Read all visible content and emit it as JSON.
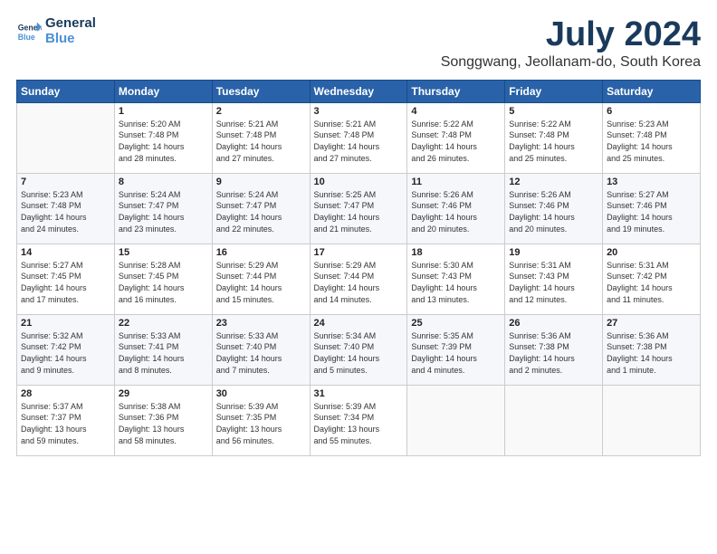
{
  "logo": {
    "line1": "General",
    "line2": "Blue"
  },
  "title": "July 2024",
  "location": "Songgwang, Jeollanam-do, South Korea",
  "days_of_week": [
    "Sunday",
    "Monday",
    "Tuesday",
    "Wednesday",
    "Thursday",
    "Friday",
    "Saturday"
  ],
  "weeks": [
    [
      {
        "day": "",
        "content": ""
      },
      {
        "day": "1",
        "content": "Sunrise: 5:20 AM\nSunset: 7:48 PM\nDaylight: 14 hours\nand 28 minutes."
      },
      {
        "day": "2",
        "content": "Sunrise: 5:21 AM\nSunset: 7:48 PM\nDaylight: 14 hours\nand 27 minutes."
      },
      {
        "day": "3",
        "content": "Sunrise: 5:21 AM\nSunset: 7:48 PM\nDaylight: 14 hours\nand 27 minutes."
      },
      {
        "day": "4",
        "content": "Sunrise: 5:22 AM\nSunset: 7:48 PM\nDaylight: 14 hours\nand 26 minutes."
      },
      {
        "day": "5",
        "content": "Sunrise: 5:22 AM\nSunset: 7:48 PM\nDaylight: 14 hours\nand 25 minutes."
      },
      {
        "day": "6",
        "content": "Sunrise: 5:23 AM\nSunset: 7:48 PM\nDaylight: 14 hours\nand 25 minutes."
      }
    ],
    [
      {
        "day": "7",
        "content": "Sunrise: 5:23 AM\nSunset: 7:48 PM\nDaylight: 14 hours\nand 24 minutes."
      },
      {
        "day": "8",
        "content": "Sunrise: 5:24 AM\nSunset: 7:47 PM\nDaylight: 14 hours\nand 23 minutes."
      },
      {
        "day": "9",
        "content": "Sunrise: 5:24 AM\nSunset: 7:47 PM\nDaylight: 14 hours\nand 22 minutes."
      },
      {
        "day": "10",
        "content": "Sunrise: 5:25 AM\nSunset: 7:47 PM\nDaylight: 14 hours\nand 21 minutes."
      },
      {
        "day": "11",
        "content": "Sunrise: 5:26 AM\nSunset: 7:46 PM\nDaylight: 14 hours\nand 20 minutes."
      },
      {
        "day": "12",
        "content": "Sunrise: 5:26 AM\nSunset: 7:46 PM\nDaylight: 14 hours\nand 20 minutes."
      },
      {
        "day": "13",
        "content": "Sunrise: 5:27 AM\nSunset: 7:46 PM\nDaylight: 14 hours\nand 19 minutes."
      }
    ],
    [
      {
        "day": "14",
        "content": "Sunrise: 5:27 AM\nSunset: 7:45 PM\nDaylight: 14 hours\nand 17 minutes."
      },
      {
        "day": "15",
        "content": "Sunrise: 5:28 AM\nSunset: 7:45 PM\nDaylight: 14 hours\nand 16 minutes."
      },
      {
        "day": "16",
        "content": "Sunrise: 5:29 AM\nSunset: 7:44 PM\nDaylight: 14 hours\nand 15 minutes."
      },
      {
        "day": "17",
        "content": "Sunrise: 5:29 AM\nSunset: 7:44 PM\nDaylight: 14 hours\nand 14 minutes."
      },
      {
        "day": "18",
        "content": "Sunrise: 5:30 AM\nSunset: 7:43 PM\nDaylight: 14 hours\nand 13 minutes."
      },
      {
        "day": "19",
        "content": "Sunrise: 5:31 AM\nSunset: 7:43 PM\nDaylight: 14 hours\nand 12 minutes."
      },
      {
        "day": "20",
        "content": "Sunrise: 5:31 AM\nSunset: 7:42 PM\nDaylight: 14 hours\nand 11 minutes."
      }
    ],
    [
      {
        "day": "21",
        "content": "Sunrise: 5:32 AM\nSunset: 7:42 PM\nDaylight: 14 hours\nand 9 minutes."
      },
      {
        "day": "22",
        "content": "Sunrise: 5:33 AM\nSunset: 7:41 PM\nDaylight: 14 hours\nand 8 minutes."
      },
      {
        "day": "23",
        "content": "Sunrise: 5:33 AM\nSunset: 7:40 PM\nDaylight: 14 hours\nand 7 minutes."
      },
      {
        "day": "24",
        "content": "Sunrise: 5:34 AM\nSunset: 7:40 PM\nDaylight: 14 hours\nand 5 minutes."
      },
      {
        "day": "25",
        "content": "Sunrise: 5:35 AM\nSunset: 7:39 PM\nDaylight: 14 hours\nand 4 minutes."
      },
      {
        "day": "26",
        "content": "Sunrise: 5:36 AM\nSunset: 7:38 PM\nDaylight: 14 hours\nand 2 minutes."
      },
      {
        "day": "27",
        "content": "Sunrise: 5:36 AM\nSunset: 7:38 PM\nDaylight: 14 hours\nand 1 minute."
      }
    ],
    [
      {
        "day": "28",
        "content": "Sunrise: 5:37 AM\nSunset: 7:37 PM\nDaylight: 13 hours\nand 59 minutes."
      },
      {
        "day": "29",
        "content": "Sunrise: 5:38 AM\nSunset: 7:36 PM\nDaylight: 13 hours\nand 58 minutes."
      },
      {
        "day": "30",
        "content": "Sunrise: 5:39 AM\nSunset: 7:35 PM\nDaylight: 13 hours\nand 56 minutes."
      },
      {
        "day": "31",
        "content": "Sunrise: 5:39 AM\nSunset: 7:34 PM\nDaylight: 13 hours\nand 55 minutes."
      },
      {
        "day": "",
        "content": ""
      },
      {
        "day": "",
        "content": ""
      },
      {
        "day": "",
        "content": ""
      }
    ]
  ]
}
